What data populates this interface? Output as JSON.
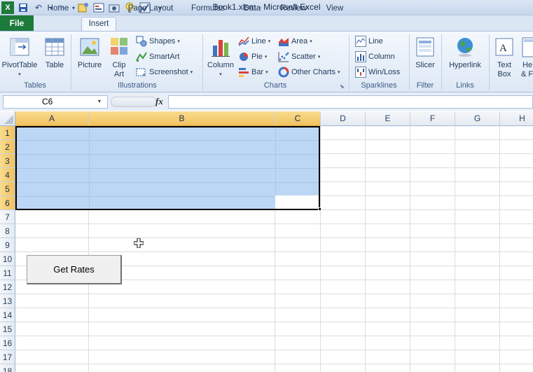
{
  "window": {
    "title": "Book1.xlsm  -  Microsoft Excel"
  },
  "tabs": {
    "file": "File",
    "items": [
      "Home",
      "Insert",
      "Page Layout",
      "Formulas",
      "Data",
      "Review",
      "View"
    ],
    "active": "Insert"
  },
  "ribbon": {
    "groups": {
      "tables": "Tables",
      "illustrations": "Illustrations",
      "charts": "Charts",
      "sparklines": "Sparklines",
      "filter": "Filter",
      "links": "Links"
    },
    "buttons": {
      "pivottable": "PivotTable",
      "table": "Table",
      "picture": "Picture",
      "clipart_1": "Clip",
      "clipart_2": "Art",
      "shapes": "Shapes",
      "smartart": "SmartArt",
      "screenshot": "Screenshot",
      "column": "Column",
      "line": "Line",
      "pie": "Pie",
      "bar": "Bar",
      "area": "Area",
      "scatter": "Scatter",
      "other_charts": "Other Charts",
      "spark_line": "Line",
      "spark_column": "Column",
      "spark_winloss": "Win/Loss",
      "slicer": "Slicer",
      "hyperlink": "Hyperlink",
      "textbox_1": "Text",
      "textbox_2": "Box",
      "header_1": "He",
      "header_2": "& F"
    }
  },
  "formula_bar": {
    "name_box": "C6",
    "fx": "fx",
    "formula": ""
  },
  "sheet": {
    "columns": [
      "A",
      "B",
      "C",
      "D",
      "E",
      "F",
      "G",
      "H"
    ],
    "rows": [
      "1",
      "2",
      "3",
      "4",
      "5",
      "6",
      "7",
      "8",
      "9",
      "10",
      "11",
      "12",
      "13",
      "14",
      "15",
      "16",
      "17",
      "18"
    ],
    "selected_columns": [
      "A",
      "B",
      "C"
    ],
    "selected_rows": [
      "1",
      "2",
      "3",
      "4",
      "5",
      "6"
    ]
  },
  "form_button": {
    "label": "Get Rates"
  },
  "colors": {
    "file_tab": "#1d7a3b",
    "selection": "#bcd7f5",
    "header_selected": "#f1c15f"
  }
}
